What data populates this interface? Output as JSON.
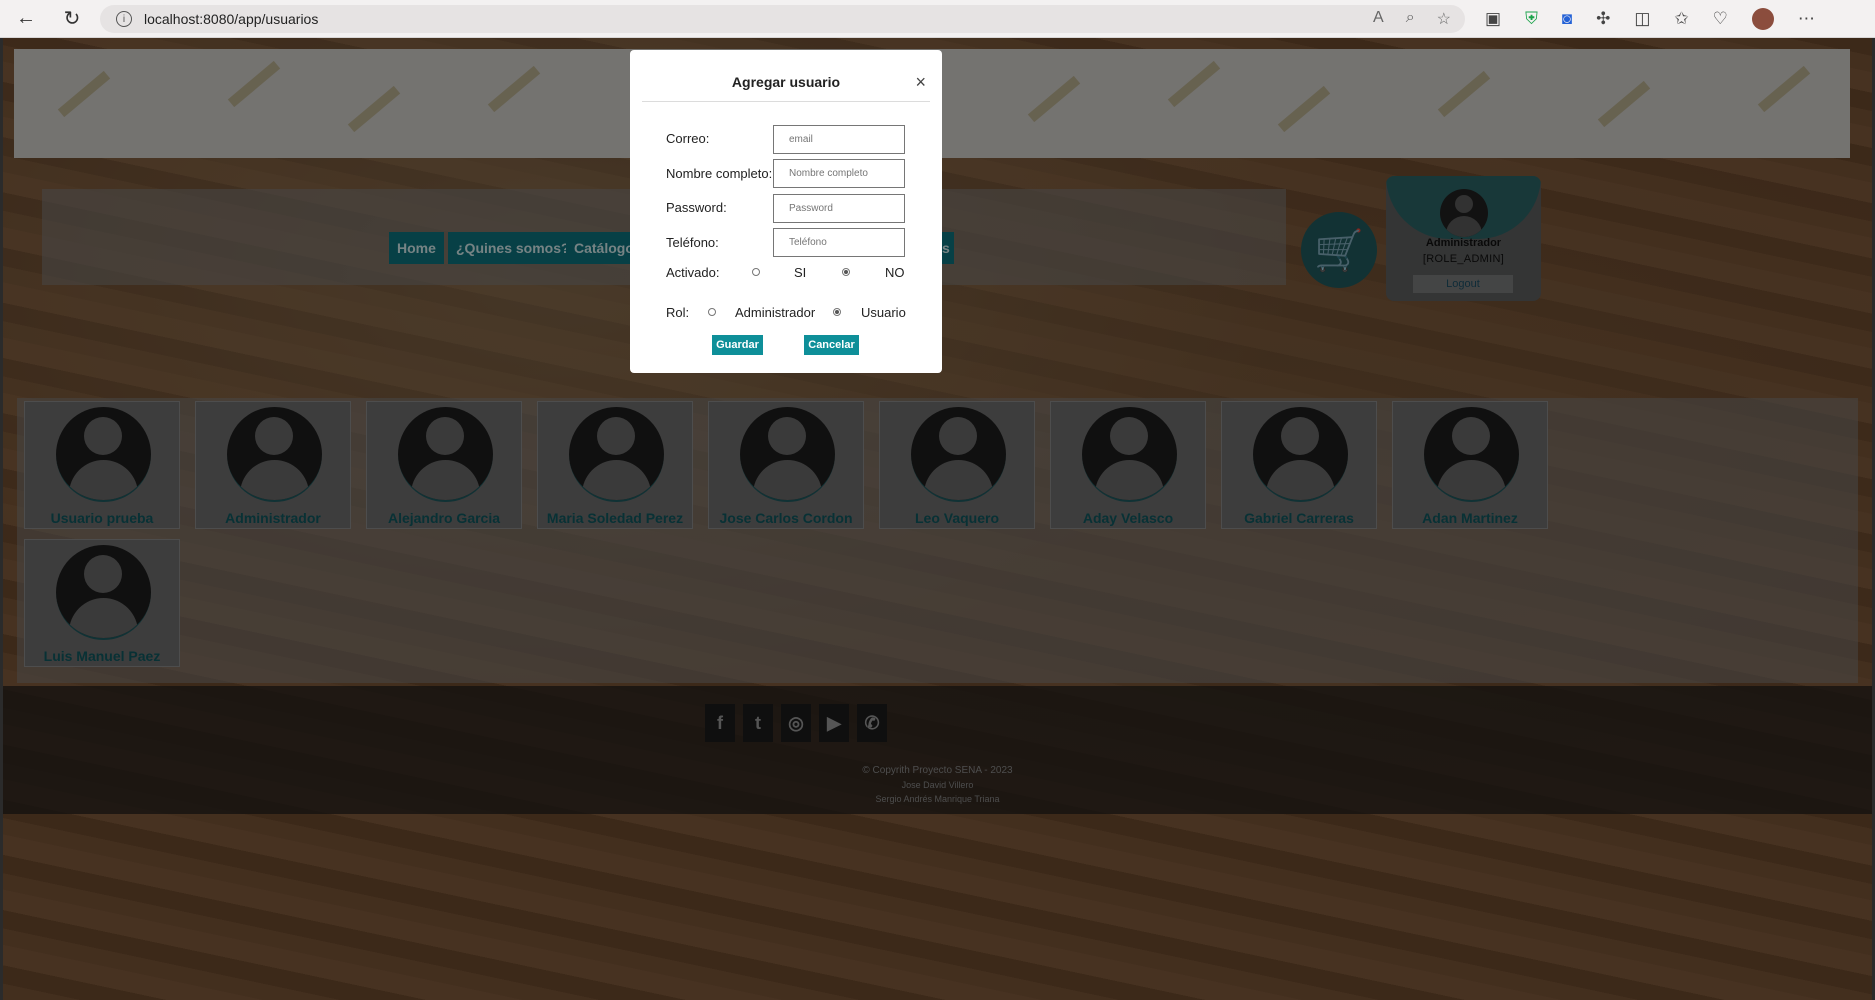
{
  "browser": {
    "url": "localhost:8080/app/usuarios",
    "icons": [
      "back-icon",
      "reload-icon",
      "info-icon",
      "read-aloud-icon",
      "zoom-icon",
      "favorite-icon",
      "collections-icon",
      "shield-icon",
      "extension-icon",
      "puzzle-icon",
      "split-icon",
      "favorites-icon",
      "health-icon",
      "profile-icon",
      "more-icon"
    ]
  },
  "nav": {
    "items": [
      {
        "label": "Home"
      },
      {
        "label": "¿Quines somos?"
      },
      {
        "label": "Catálogo"
      },
      {
        "label": "s"
      }
    ]
  },
  "user_panel": {
    "name": "Administrador",
    "role": "[ROLE_ADMIN]",
    "logout_label": "Logout"
  },
  "users": [
    {
      "name": "Usuario prueba"
    },
    {
      "name": "Administrador"
    },
    {
      "name": "Alejandro Garcia"
    },
    {
      "name": "Maria Soledad Perez"
    },
    {
      "name": "Jose Carlos Cordon"
    },
    {
      "name": "Leo Vaquero"
    },
    {
      "name": "Aday Velasco"
    },
    {
      "name": "Gabriel Carreras"
    },
    {
      "name": "Adan Martinez"
    },
    {
      "name": "Luis Manuel Paez"
    }
  ],
  "footer": {
    "social": [
      "facebook-icon",
      "twitter-icon",
      "instagram-icon",
      "youtube-icon",
      "whatsapp-icon"
    ],
    "copyright": "© Copyrith Proyecto SENA - 2023",
    "author1": "Jose David Villero",
    "author2": "Sergio Andrés Manrique Triana"
  },
  "modal": {
    "title": "Agregar usuario",
    "close": "×",
    "fields": {
      "correo": {
        "label": "Correo:",
        "placeholder": "email"
      },
      "nombre": {
        "label": "Nombre completo:",
        "placeholder": "Nombre completo"
      },
      "password": {
        "label": "Password:",
        "placeholder": "Password"
      },
      "telefono": {
        "label": "Teléfono:",
        "placeholder": "Teléfono"
      }
    },
    "activado": {
      "label": "Activado:",
      "si": "SI",
      "no": "NO",
      "selected": "NO"
    },
    "rol": {
      "label": "Rol:",
      "admin": "Administrador",
      "usuario": "Usuario",
      "selected": "Usuario"
    },
    "save_label": "Guardar",
    "cancel_label": "Cancelar"
  },
  "colors": {
    "accent": "#0e8f99",
    "nav_button": "#0e7580",
    "card_name": "#0f5a62"
  }
}
